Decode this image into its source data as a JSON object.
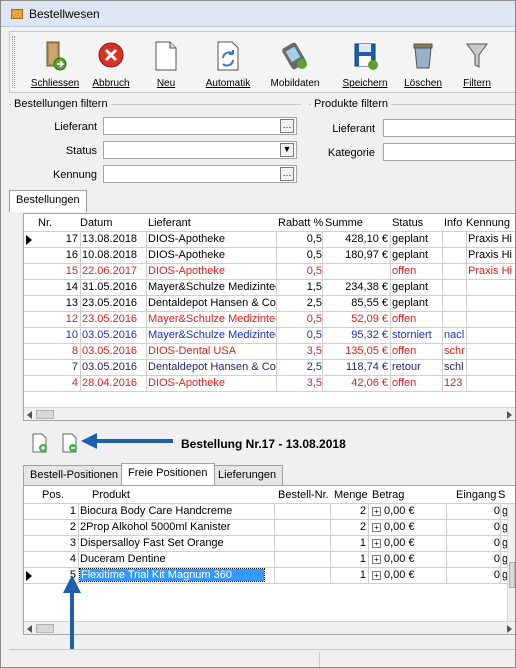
{
  "window": {
    "title": "Bestellwesen"
  },
  "toolbar": {
    "buttons": [
      {
        "id": "schliessen",
        "label": "Schliessen",
        "icon": "door-exit-icon",
        "color": "#6b8e3a"
      },
      {
        "id": "abbruch",
        "label": "Abbruch",
        "icon": "cancel-icon",
        "color": "#d9302a"
      },
      {
        "id": "neu",
        "label": "Neu",
        "icon": "new-document-icon",
        "color": "#9a9a9a"
      },
      {
        "id": "automatik",
        "label": "Automatik",
        "icon": "automatic-icon",
        "color": "#3a78c9"
      },
      {
        "id": "mobildaten",
        "label": "Mobildaten",
        "icon": "mobile-device-icon",
        "color": "#6a6a6a"
      },
      {
        "id": "speichern",
        "label": "Speichern",
        "icon": "save-icon",
        "color": "#1f5fa8"
      },
      {
        "id": "loeschen",
        "label": "Löschen",
        "icon": "trash-icon",
        "color": "#8a7a55"
      },
      {
        "id": "filtern",
        "label": "Filtern",
        "icon": "filter-funnel-icon",
        "color": "#6f6f6f"
      }
    ]
  },
  "filters": {
    "orders_group": "Bestellungen filtern",
    "products_group": "Produkte filtern",
    "orders_fields": [
      {
        "label": "Lieferant",
        "value": ""
      },
      {
        "label": "Status",
        "value": ""
      },
      {
        "label": "Kennung",
        "value": ""
      }
    ],
    "products_fields": [
      {
        "label": "Lieferant",
        "value": ""
      },
      {
        "label": "Kategorie",
        "value": ""
      }
    ]
  },
  "orders": {
    "tab": "Bestellungen",
    "columns": [
      "Nr.",
      "Datum",
      "Lieferant",
      "Rabatt %",
      "Summe",
      "Status",
      "Info",
      "Kennung"
    ],
    "rows": [
      {
        "nr": "17",
        "datum": "13.08.2018",
        "lieferant": "DIOS-Apotheke",
        "rabatt": "0,5",
        "summe": "428,10 €",
        "status": "geplant",
        "info": "",
        "kennung": "Praxis Hi",
        "color": "#000000",
        "current": true
      },
      {
        "nr": "16",
        "datum": "10.08.2018",
        "lieferant": "DIOS-Apotheke",
        "rabatt": "0,5",
        "summe": "180,97 €",
        "status": "geplant",
        "info": "",
        "kennung": "Praxis Hi",
        "color": "#000000",
        "current": false
      },
      {
        "nr": "15",
        "datum": "22.06.2017",
        "lieferant": "DIOS-Apotheke",
        "rabatt": "0,5",
        "summe": "",
        "status": "offen",
        "info": "",
        "kennung": "Praxis Hi",
        "color": "#e02020",
        "current": false
      },
      {
        "nr": "14",
        "datum": "31.05.2016",
        "lieferant": "Mayer&Schulze Medizintec",
        "rabatt": "1,5",
        "summe": "234,38 €",
        "status": "geplant",
        "info": "",
        "kennung": "",
        "color": "#000000",
        "current": false
      },
      {
        "nr": "13",
        "datum": "23.05.2016",
        "lieferant": "Dentaldepot Hansen & Co.",
        "rabatt": "2,5",
        "summe": "85,55 €",
        "status": "geplant",
        "info": "",
        "kennung": "",
        "color": "#000000",
        "current": false
      },
      {
        "nr": "12",
        "datum": "23.05.2016",
        "lieferant": "Mayer&Schulze Medizintec",
        "rabatt": "0,5",
        "summe": "52,09 €",
        "status": "offen",
        "info": "",
        "kennung": "",
        "color": "#e02020",
        "current": false
      },
      {
        "nr": "10",
        "datum": "03.05.2016",
        "lieferant": "Mayer&Schulze Medizintec",
        "rabatt": "0,5",
        "summe": "95,32 €",
        "status": "storniert",
        "info": "nacl",
        "kennung": "",
        "color": "#1a2fd0",
        "current": false
      },
      {
        "nr": "8",
        "datum": "03.05.2016",
        "lieferant": "DIOS-Dental USA",
        "rabatt": "3,5",
        "summe": "135,05 €",
        "status": "offen",
        "info": "schr",
        "kennung": "",
        "color": "#e02020",
        "current": false
      },
      {
        "nr": "7",
        "datum": "03.05.2016",
        "lieferant": "Dentaldepot Hansen & Co.",
        "rabatt": "2,5",
        "summe": "118,74 €",
        "status": "retour",
        "info": "schl",
        "kennung": "",
        "color": "#22286e",
        "current": false
      },
      {
        "nr": "4",
        "datum": "28.04.2016",
        "lieferant": "DIOS-Apotheke",
        "rabatt": "3,5",
        "summe": "42,06 €",
        "status": "offen",
        "info": "123",
        "kennung": "",
        "color": "#e02020",
        "current": false
      }
    ]
  },
  "detail": {
    "heading": "Bestellung Nr.17 - 13.08.2018",
    "icons": [
      "add-item-icon",
      "remove-item-icon"
    ],
    "tabs": [
      "Bestell-Positionen",
      "Freie Positionen",
      "Lieferungen"
    ],
    "active_tab": 1,
    "columns": [
      "Pos.",
      "Produkt",
      "Bestell-Nr.",
      "Menge",
      "Betrag",
      "Eingang",
      "S"
    ],
    "rows": [
      {
        "pos": "1",
        "produkt": "Biocura Body Care Handcreme",
        "bestellnr": "",
        "menge": "2",
        "betrag": "0,00 €",
        "eingang": "0",
        "s": "g",
        "selected": false
      },
      {
        "pos": "2",
        "produkt": "2Prop Alkohol 5000ml Kanister",
        "bestellnr": "",
        "menge": "2",
        "betrag": "0,00 €",
        "eingang": "0",
        "s": "g",
        "selected": false
      },
      {
        "pos": "3",
        "produkt": "Dispersalloy Fast Set Orange",
        "bestellnr": "",
        "menge": "1",
        "betrag": "0,00 €",
        "eingang": "0",
        "s": "g",
        "selected": false
      },
      {
        "pos": "4",
        "produkt": "Duceram Dentine",
        "bestellnr": "",
        "menge": "1",
        "betrag": "0,00 €",
        "eingang": "0",
        "s": "g",
        "selected": false
      },
      {
        "pos": "5",
        "produkt": "Flexitime Trial Kit Magnum 360",
        "bestellnr": "",
        "menge": "1",
        "betrag": "0,00 €",
        "eingang": "0",
        "s": "g",
        "selected": true
      }
    ]
  },
  "colors": {
    "selection": "#3399ff",
    "annotation_arrow": "#1f5fa8",
    "tab_border": "#a0a0a0"
  }
}
